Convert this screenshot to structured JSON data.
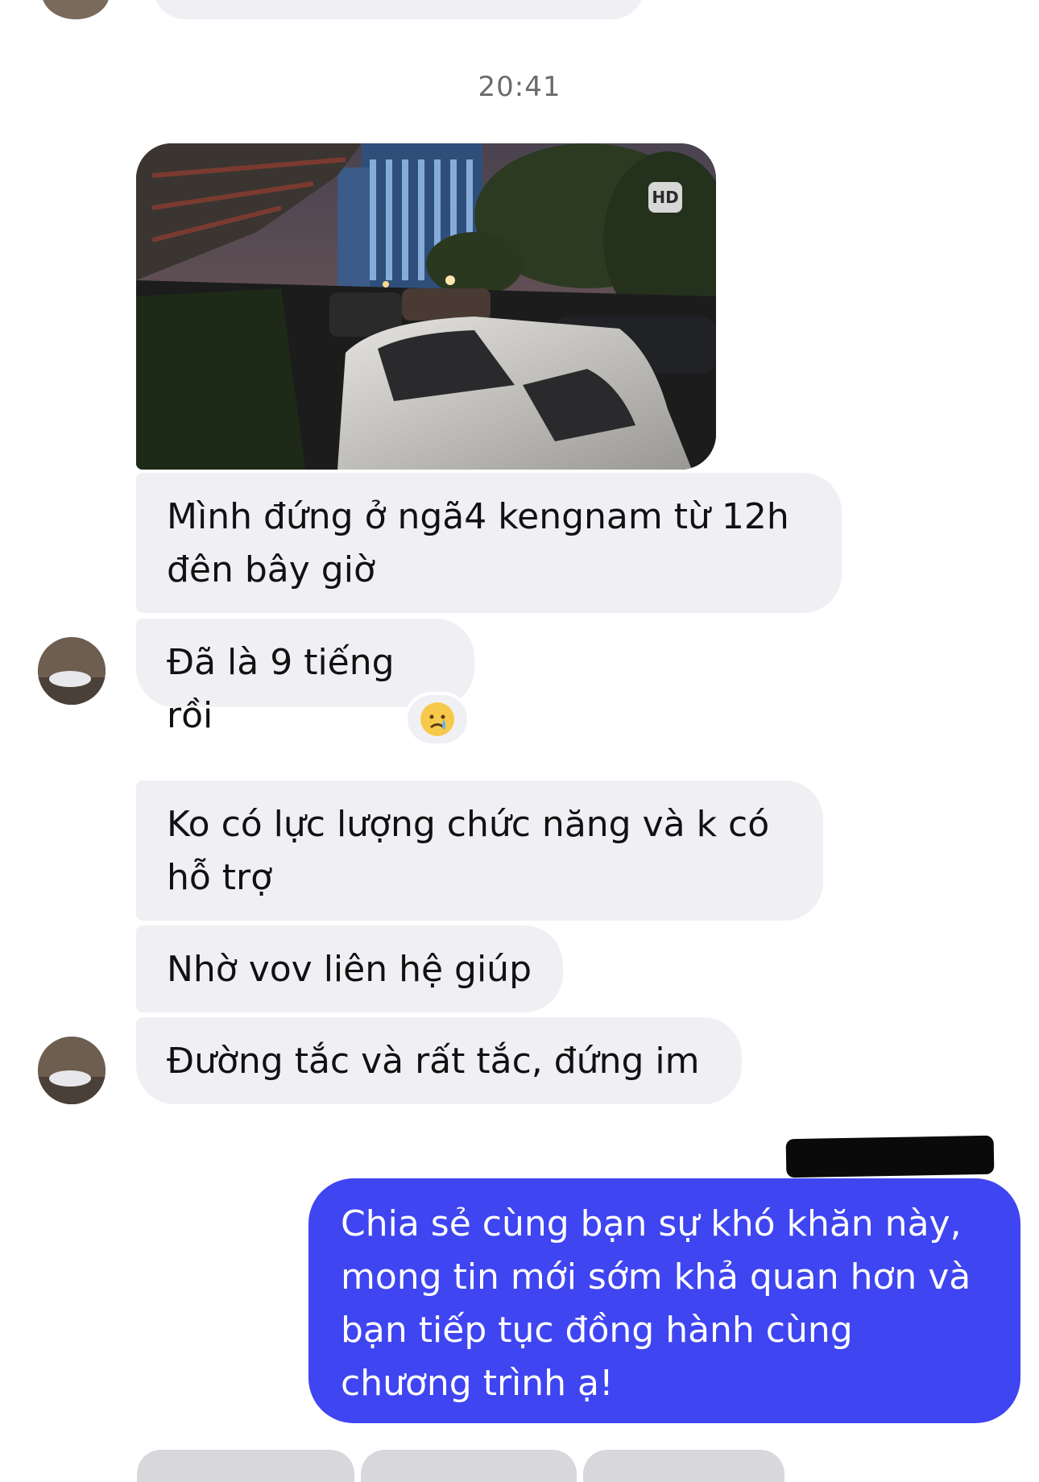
{
  "conversation": {
    "timestamp": "20:41",
    "photo": {
      "badge": "HD",
      "icon": "photo-image"
    },
    "incoming": [
      {
        "text": "Mình đứng ở ngã4 kengnam từ 12h\nđên bây giờ"
      },
      {
        "text": "Đã là 9 tiếng rồi",
        "reaction": "crying-face-emoji"
      },
      {
        "text": "Ko có lực lượng chức năng và k có\nhỗ trợ"
      },
      {
        "text": "Nhờ vov liên hệ giúp"
      },
      {
        "text": "Đường tắc và rất tắc, đứng im"
      }
    ],
    "outgoing": [
      {
        "text": "Chia sẻ cùng bạn sự khó khăn này,\nmong tin mới sớm khả quan hơn và\nbạn tiếp tục đồng hành cùng\nchương trình ạ!"
      }
    ]
  },
  "colors": {
    "incoming_bubble": "#f0f0f4",
    "outgoing_bubble": "#3f45f0",
    "timestamp": "#6b6b6b"
  }
}
